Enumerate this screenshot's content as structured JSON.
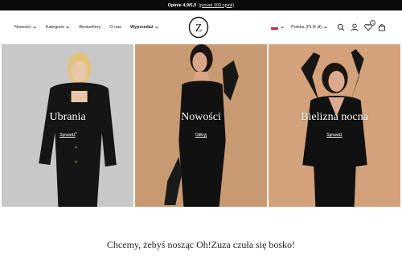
{
  "topbar": {
    "rating": "Opinie 4,9/5,0",
    "reviews_link": "(ponad 300 opinii)"
  },
  "nav": {
    "items": [
      {
        "label": "Nowości",
        "dropdown": true
      },
      {
        "label": "Kategorie",
        "dropdown": true
      },
      {
        "label": "Bestsellery",
        "dropdown": false
      },
      {
        "label": "O nas",
        "dropdown": false
      },
      {
        "label": "Wyprzedaż",
        "dropdown": true
      }
    ]
  },
  "logo": {
    "text": "Z"
  },
  "header_right": {
    "country": "Polska (PLN zł)",
    "icons": [
      "search-icon",
      "user-icon",
      "wishlist-icon",
      "cart-icon"
    ],
    "wishlist_count": "0"
  },
  "panels": [
    {
      "title": "Ubrania",
      "cta": "Sprawdź",
      "bg": "#c7c7c7"
    },
    {
      "title": "Nowości",
      "cta": "Odkryj",
      "bg": "#c99b73"
    },
    {
      "title": "Bielizna nocna",
      "cta": "Sprawdź",
      "bg": "#d3a27a"
    }
  ],
  "tagline": "Chcemy, żebyś nosząc Oh!Zuza czuła się bosko!",
  "colors": {
    "topbar": "#0b0b0b",
    "text": "#222222"
  }
}
